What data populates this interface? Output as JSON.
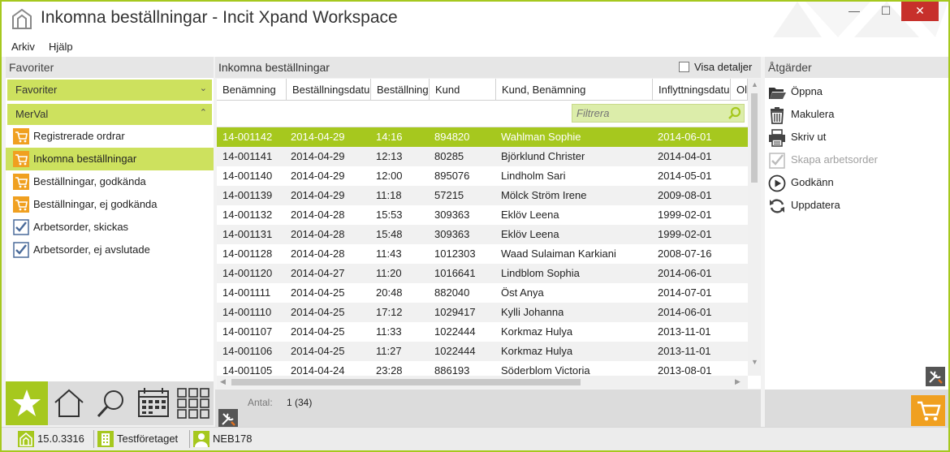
{
  "window": {
    "title": "Inkomna beställningar - Incit Xpand Workspace",
    "minimize": "—",
    "maximize": "☐",
    "close": "✕"
  },
  "menu": {
    "items": [
      "Arkiv",
      "Hjälp"
    ]
  },
  "left": {
    "header": "Favoriter",
    "groups": [
      {
        "label": "Favoriter",
        "chevron": "⌄"
      },
      {
        "label": "MerVal",
        "chevron": "⌃"
      }
    ],
    "items": [
      {
        "label": "Registrerade ordrar",
        "icon": "cart-icon"
      },
      {
        "label": "Inkomna beställningar",
        "icon": "cart-icon",
        "selected": true
      },
      {
        "label": "Beställningar, godkända",
        "icon": "cart-icon"
      },
      {
        "label": "Beställningar, ej godkända",
        "icon": "cart-icon"
      },
      {
        "label": "Arbetsorder, skickas",
        "icon": "checklist-icon"
      },
      {
        "label": "Arbetsorder, ej avslutade",
        "icon": "checklist-icon"
      }
    ],
    "tabs": [
      "star-icon",
      "home-icon",
      "search-icon",
      "calendar-icon",
      "grid-icon"
    ]
  },
  "center": {
    "title": "Inkomna beställningar",
    "visa_detaljer": "Visa detaljer",
    "filter_placeholder": "Filtrera",
    "columns": [
      "Benämning",
      "Beställningsdatum",
      "Beställningstid",
      "Kund",
      "Kund, Benämning",
      "Inflyttningsdatum",
      "Ol"
    ],
    "rows": [
      [
        "14-001142",
        "2014-04-29",
        "14:16",
        "894820",
        "Wahlman Sophie",
        "2014-06-01"
      ],
      [
        "14-001141",
        "2014-04-29",
        "12:13",
        "80285",
        "Björklund Christer",
        "2014-04-01"
      ],
      [
        "14-001140",
        "2014-04-29",
        "12:00",
        "895076",
        "Lindholm Sari",
        "2014-05-01"
      ],
      [
        "14-001139",
        "2014-04-29",
        "11:18",
        "57215",
        "Mölck Ström Irene",
        "2009-08-01"
      ],
      [
        "14-001132",
        "2014-04-28",
        "15:53",
        "309363",
        "Eklöv Leena",
        "1999-02-01"
      ],
      [
        "14-001131",
        "2014-04-28",
        "15:48",
        "309363",
        "Eklöv Leena",
        "1999-02-01"
      ],
      [
        "14-001128",
        "2014-04-28",
        "11:43",
        "1012303",
        "Waad Sulaiman Karkiani",
        "2008-07-16"
      ],
      [
        "14-001120",
        "2014-04-27",
        "11:20",
        "1016641",
        "Lindblom Sophia",
        "2014-06-01"
      ],
      [
        "14-001111",
        "2014-04-25",
        "20:48",
        "882040",
        "Öst Anya",
        "2014-07-01"
      ],
      [
        "14-001110",
        "2014-04-25",
        "17:12",
        "1029417",
        "Kylli Johanna",
        "2014-06-01"
      ],
      [
        "14-001107",
        "2014-04-25",
        "11:33",
        "1022444",
        "Korkmaz Hulya",
        "2013-11-01"
      ],
      [
        "14-001106",
        "2014-04-25",
        "11:27",
        "1022444",
        "Korkmaz Hulya",
        "2013-11-01"
      ],
      [
        "14-001105",
        "2014-04-24",
        "23:28",
        "886193",
        "Söderblom Victoria",
        "2013-08-01"
      ]
    ],
    "antal_label": "Antal:",
    "antal_value": "1  (34)"
  },
  "right": {
    "header": "Åtgärder",
    "actions": [
      {
        "label": "Öppna",
        "icon": "folder-open-icon",
        "enabled": true
      },
      {
        "label": "Makulera",
        "icon": "trash-icon",
        "enabled": true
      },
      {
        "label": "Skriv ut",
        "icon": "printer-icon",
        "enabled": true
      },
      {
        "label": "Skapa arbetsorder",
        "icon": "checklist-icon",
        "enabled": false
      },
      {
        "label": "Godkänn",
        "icon": "play-circle-icon",
        "enabled": true
      },
      {
        "label": "Uppdatera",
        "icon": "refresh-icon",
        "enabled": true
      }
    ]
  },
  "status": {
    "version": "15.0.3316",
    "company": "Testföretaget",
    "user": "NEB178"
  },
  "colors": {
    "accent": "#a6c81e",
    "accent_light": "#cde15e",
    "cart_orange": "#f0a020",
    "close_red": "#c7302b"
  }
}
